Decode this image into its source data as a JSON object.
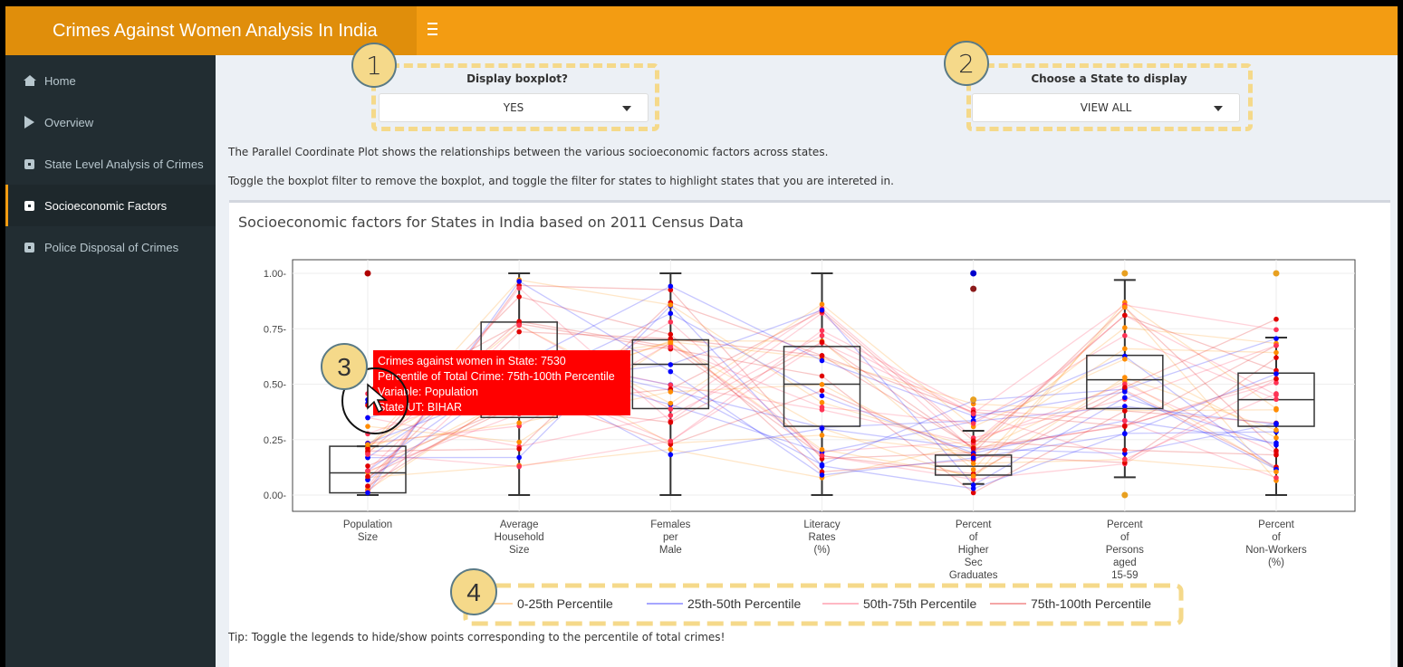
{
  "app": {
    "title": "Crimes Against Women Analysis In India"
  },
  "sidebar": {
    "items": [
      {
        "label": "Home",
        "icon": "home-icon"
      },
      {
        "label": "Overview",
        "icon": "play-icon"
      },
      {
        "label": "State Level Analysis of Crimes",
        "icon": "square-icon"
      },
      {
        "label": "Socioeconomic Factors",
        "icon": "square-icon",
        "active": true
      },
      {
        "label": "Police Disposal of Crimes",
        "icon": "square-icon"
      }
    ]
  },
  "controls": {
    "boxplot_label": "Display boxplot?",
    "boxplot_value": "YES",
    "state_label": "Choose a State to display",
    "state_value": "VIEW ALL"
  },
  "markers": [
    "1",
    "2",
    "3",
    "4"
  ],
  "text": {
    "desc1": "The Parallel Coordinate Plot shows the relationships between the various socioeconomic factors across states.",
    "desc2": "Toggle the boxplot filter to remove the boxplot, and toggle the filter for states to highlight states that you are intereted in.",
    "tip": "Tip: Toggle the legends to hide/show points corresponding to the percentile of total crimes!"
  },
  "colors": {
    "header": "#f39c12",
    "sidebar": "#222d32",
    "p0_25": "#ff8c00",
    "p25_50": "#0000ff",
    "p50_75": "#ff3355",
    "p75_100": "#e00000",
    "tooltip": "#ff0000"
  },
  "tooltip": {
    "lines": [
      "Crimes against women in State: 7530",
      "Percentile of Total Crime:  75th-100th Percentile",
      "Variable: Population",
      "State UT: BIHAR"
    ]
  },
  "chart_data": {
    "type": "box",
    "title": "Socioeconomic factors for States in India based on 2011 Census Data",
    "ylim": [
      0,
      1
    ],
    "yticks": [
      "0.00",
      "0.25",
      "0.50",
      "0.75",
      "1.00"
    ],
    "grid": true,
    "categories": [
      "Population\nSize",
      "Average\nHousehold\nSize",
      "Females\nper\nMale",
      "Literacy\nRates\n(%)",
      "Percent\nof\nHigher\nSec\nGraduates",
      "Percent\nof\nPersons\naged\n15-59",
      "Percent\nof\nNon-Workers\n(%)"
    ],
    "boxes": [
      {
        "min": 0.0,
        "q1": 0.01,
        "median": 0.1,
        "q3": 0.22,
        "max": 0.0
      },
      {
        "min": 0.0,
        "q1": 0.35,
        "median": 0.55,
        "q3": 0.78,
        "max": 1.0
      },
      {
        "min": 0.0,
        "q1": 0.39,
        "median": 0.59,
        "q3": 0.7,
        "max": 1.0
      },
      {
        "min": 0.0,
        "q1": 0.31,
        "median": 0.5,
        "q3": 0.67,
        "max": 1.0
      },
      {
        "min": 0.05,
        "q1": 0.09,
        "median": 0.13,
        "q3": 0.18,
        "max": 0.29
      },
      {
        "min": 0.08,
        "q1": 0.39,
        "median": 0.52,
        "q3": 0.63,
        "max": 0.97
      },
      {
        "min": 0.0,
        "q1": 0.31,
        "median": 0.43,
        "q3": 0.55,
        "max": 0.71
      }
    ],
    "series": [
      {
        "name": "0-25th Percentile"
      },
      {
        "name": "25th-50th Percentile"
      },
      {
        "name": "50th-75th Percentile"
      },
      {
        "name": "75th-100th Percentile"
      }
    ],
    "legend_position": "bottom"
  },
  "modebar_icons": [
    "camera-icon",
    "zoom-icon",
    "pan-icon",
    "box-select-icon",
    "lasso-icon",
    "zoom-in-icon",
    "zoom-out-icon",
    "autoscale-icon",
    "reset-icon",
    "spike-icon",
    "hover-closest-icon",
    "hover-compare-icon",
    "plotly-logo-icon"
  ]
}
